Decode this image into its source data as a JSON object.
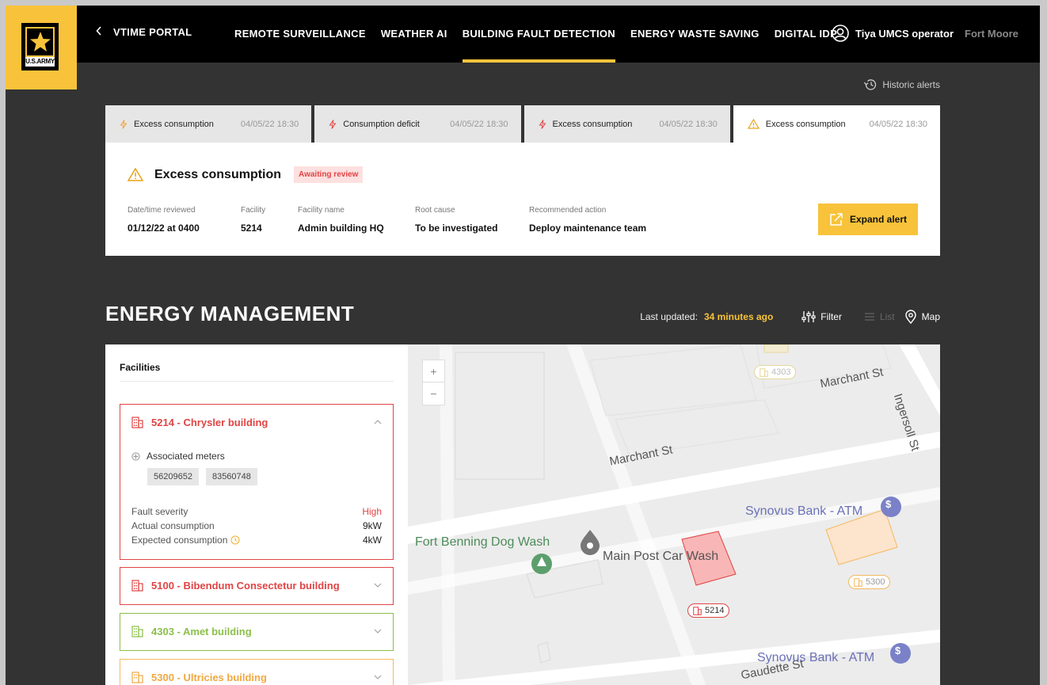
{
  "brand": {
    "emblem_text": "U.S.ARMY",
    "accent": "#f8c33a"
  },
  "nav": {
    "back_label": "VTIME PORTAL",
    "items": [
      {
        "label": "REMOTE SURVEILLANCE"
      },
      {
        "label": "WEATHER AI"
      },
      {
        "label": "BUILDING FAULT DETECTION"
      },
      {
        "label": "ENERGY WASTE SAVING"
      },
      {
        "label": "DIGITAL IDP"
      }
    ],
    "active_index": 2,
    "user_name": "Tiya UMCS operator",
    "location": "Fort Moore"
  },
  "historic_label": "Historic alerts",
  "alert_tabs": [
    {
      "label": "Excess consumption",
      "time": "04/05/22 18:30",
      "icon": "bolt-icon"
    },
    {
      "label": "Consumption deficit",
      "time": "04/05/22 18:30",
      "icon": "bolt-icon"
    },
    {
      "label": "Excess consumption",
      "time": "04/05/22 18:30",
      "icon": "bolt-icon"
    },
    {
      "label": "Excess consumption",
      "time": "04/05/22 18:30",
      "icon": "warning-icon"
    }
  ],
  "alert": {
    "title": "Excess consumption",
    "status": "Awaiting review",
    "fields": [
      {
        "label": "Date/time reviewed",
        "value": "01/12/22 at 0400"
      },
      {
        "label": "Facility",
        "value": "5214"
      },
      {
        "label": "Facility name",
        "value": "Admin building HQ"
      },
      {
        "label": "Root cause",
        "value": "To be investigated"
      },
      {
        "label": "Recommended action",
        "value": "Deploy maintenance team"
      }
    ],
    "expand_label": "Expand alert"
  },
  "energy": {
    "title": "ENERGY MANAGEMENT",
    "last_updated_label": "Last updated:",
    "last_updated_value": "34 minutes ago",
    "filter_label": "Filter",
    "list_label": "List",
    "map_label": "Map"
  },
  "facilities": {
    "heading": "Facilities",
    "items": [
      {
        "title": "5214 - Chrysler building",
        "color": "#e04444",
        "meters_label": "Associated meters",
        "meters": [
          "56209652",
          "83560748"
        ],
        "stats": [
          {
            "label": "Fault severity",
            "value": "High"
          },
          {
            "label": "Actual consumption",
            "value": "9kW"
          },
          {
            "label": "Expected consumption",
            "value": "4kW"
          }
        ]
      },
      {
        "title": "5100 - Bibendum Consectetur building",
        "color": "#e04444"
      },
      {
        "title": "4303 - Amet building",
        "color": "#8cbf4a"
      },
      {
        "title": "5300 - Ultricies building",
        "color": "#f5b860"
      }
    ]
  },
  "map": {
    "zoom_in": "+",
    "zoom_out": "−",
    "streets": [
      "Marchant St",
      "Marchant St",
      "Ingersoll St",
      "Gaudette St"
    ],
    "places": [
      "Fort Benning Dog Wash",
      "Main Post Car Wash",
      "Synovus Bank - ATM",
      "Synovus Bank - ATM"
    ],
    "badges": [
      "4303",
      "5300",
      "5214"
    ]
  }
}
